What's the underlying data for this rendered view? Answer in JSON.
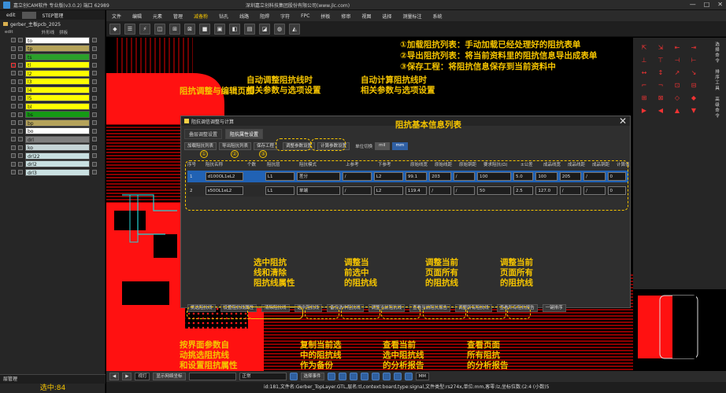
{
  "window": {
    "title": "嘉立创CAM软件 专业版(v3.0.2) 端口 62989",
    "company": "深圳嘉立创科技集团股份有限公司(www.jlc.com)",
    "controls": [
      "—",
      "□",
      "✕"
    ]
  },
  "left_panel": {
    "tabs": [
      "edit",
      "",
      "STEP管理"
    ],
    "job_name": "gerber_主板pcb_2025",
    "step": "edit",
    "step_options": [
      "外形线",
      "拼板"
    ],
    "layers": [
      {
        "name": "to",
        "color": "#ffffff"
      },
      {
        "name": "tp",
        "color": "#b5a35a"
      },
      {
        "name": "ts",
        "color": "#2aa02a"
      },
      {
        "name": "tl",
        "color": "#ffff00"
      },
      {
        "name": "l2",
        "color": "#ffff00"
      },
      {
        "name": "l3",
        "color": "#ffff00"
      },
      {
        "name": "l4",
        "color": "#ffff00"
      },
      {
        "name": "l5",
        "color": "#ffff00"
      },
      {
        "name": "bl",
        "color": "#ffff00"
      },
      {
        "name": "bs",
        "color": "#159a15"
      },
      {
        "name": "bp",
        "color": "#b5a35a"
      },
      {
        "name": "bo",
        "color": "#ffffff"
      },
      {
        "name": "drl",
        "color": "#7f7f7f"
      },
      {
        "name": "ko",
        "color": "#c5d4d6"
      },
      {
        "name": "drl22",
        "color": "#c9e0e1"
      },
      {
        "name": "drl2",
        "color": "#c9e0e1"
      },
      {
        "name": "drl3",
        "color": "#c9e0e1"
      }
    ],
    "bottom_tab": "层管理",
    "selected_count": "选中:84"
  },
  "menus": [
    "文件",
    "编辑",
    "元素",
    "管理",
    "减备粉",
    "钻孔",
    "线路",
    "阻焊",
    "字符",
    "FPC",
    "拼板",
    "修审",
    "视图",
    "选择",
    "测量标注",
    "系统"
  ],
  "active_menu": "减备粉",
  "toolbar_icons": [
    "◆",
    "☰",
    "⚡",
    "◫",
    "⊞",
    "⊠",
    "■",
    "▣",
    "◧",
    "▤",
    "◪",
    "◍",
    "◭"
  ],
  "dialog": {
    "title": "阻抗调信调整与计算",
    "close": "✕",
    "tabs": [
      "叠层调整设置",
      "阻抗属性设置"
    ],
    "buttons": [
      "加载阻抗列表",
      "导出阻抗列表",
      "保存工程",
      "调整参数设置",
      "计算参数设置"
    ],
    "unit_label": "单位切换",
    "units": [
      "mil",
      "mm"
    ],
    "columns": [
      "序号",
      "阻抗名称",
      "个数",
      "阻抗层",
      "阻抗模式",
      "上参考",
      "下参考",
      "原始线宽",
      "原始线距",
      "原始铜距",
      "要求阻抗(Ω)",
      "±公差",
      "成品线宽",
      "成品线距",
      "成品铜距",
      "计算值"
    ],
    "rows": [
      [
        "1",
        "d100OL1eL2",
        "",
        "L1",
        "差分",
        "/",
        "L2",
        "99.1",
        "203",
        "/",
        "100",
        "5.0",
        "100",
        "205",
        "/",
        "0"
      ],
      [
        "2",
        "s50OL1eL2",
        "",
        "L1",
        "单端",
        "/",
        "L2",
        "119.4",
        "/",
        "/",
        "50",
        "2.5",
        "127.0",
        "/",
        "/",
        "0"
      ]
    ],
    "bottom_buttons": [
      "挑选阻抗线",
      "设置阻抗线属性",
      "清除阻抗线",
      "选中阻抗线",
      "备份选中阻抗线",
      "调整当前阻抗线",
      "查看当前阻抗报告",
      "调整所有阻抗线",
      "查看所有阻抗报告",
      "一键排序"
    ]
  },
  "annotations": {
    "top_right": [
      "①加载阻抗列表：手动加载已经处理好的阻抗表单",
      "②导出阻抗列表：将当前资料里的阻抗信息导出成表单",
      "③保存工程：将阻抗信息保存到当前资料中"
    ],
    "edit_page": "阻抗调整与编辑页面",
    "auto_adjust": [
      "自动调整阻抗线时",
      "相关参数与选项设置"
    ],
    "auto_calc": [
      "自动计算阻抗线时",
      "相关参数与选项设置"
    ],
    "basic_info": "阻抗基本信息列表",
    "circle_labels": [
      "①",
      "②",
      "③"
    ],
    "select_clear": [
      "选中阻抗",
      "线和清除",
      "阻抗线属性"
    ],
    "adjust_current": [
      "调整当",
      "前选中",
      "的阻抗线"
    ],
    "adjust_all": [
      "调整当前",
      "页面所有",
      "的阻抗线"
    ],
    "sort_all": [
      "调整当前",
      "页面所有",
      "的阻抗线"
    ],
    "auto_pick": [
      "按界面参数自",
      "动挑选阻抗线",
      "和设置阻抗属性"
    ],
    "copy_backup": [
      "复制当前选",
      "中的阻抗线",
      "作为备份"
    ],
    "view_current": [
      "查看当前",
      "选中阻抗线",
      "的分析报告"
    ],
    "view_all": [
      "查看页面",
      "所有阻抗",
      "的分析报告"
    ]
  },
  "right_panel": {
    "side_labels": [
      "选",
      "择",
      "命",
      "令",
      "",
      "排",
      "序",
      "工",
      "具",
      "",
      "高",
      "级",
      "命",
      "令"
    ]
  },
  "bottom_bar": {
    "zoom_mode": "视打",
    "show_button": "显示网络坐标",
    "grid": "正常",
    "mode_select": "选择事件",
    "unit": "MM"
  },
  "status_text": "id:181,文件名:Gerber_TopLayer.GTL,层名:tl,context:board,type:signal,文件类型:rs274x,单位:mm,客零:lz,坐标位数:(2:4 (小数)5"
}
